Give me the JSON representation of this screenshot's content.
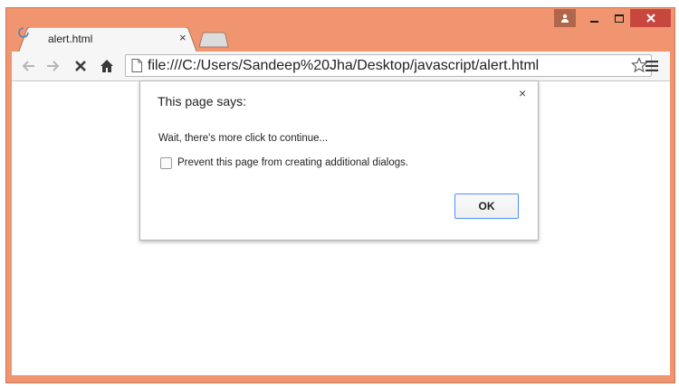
{
  "window": {
    "frame_color": "#f0956f",
    "close_button_color": "#c7473f"
  },
  "tabs": [
    {
      "title": "alert.html",
      "loading": true
    }
  ],
  "toolbar": {
    "url": "file:///C:/Users/Sandeep%20Jha/Desktop/javascript/alert.html"
  },
  "icons": {
    "back": "arrow-left-icon",
    "forward": "arrow-right-icon",
    "stop": "stop-icon",
    "home": "home-icon",
    "page": "page-icon",
    "bookmark": "star-icon",
    "menu": "hamburger-menu-icon"
  },
  "dialog": {
    "title": "This page says:",
    "message": "Wait, there's more click to continue...",
    "checkbox_label": "Prevent this page from creating additional dialogs.",
    "checkbox_checked": false,
    "ok_label": "OK",
    "close_glyph": "×"
  }
}
